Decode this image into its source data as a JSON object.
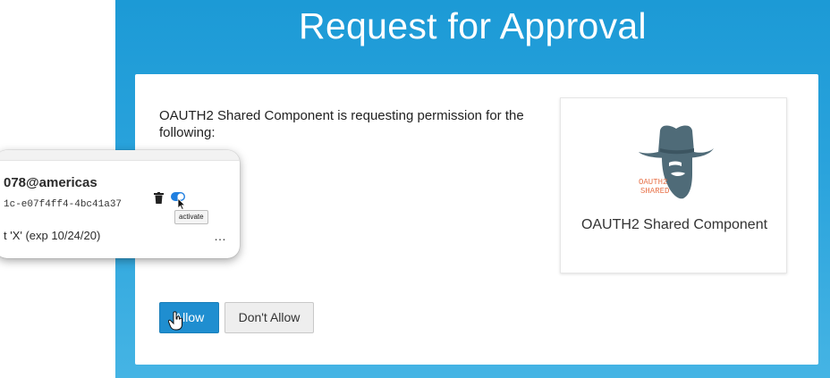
{
  "header": {
    "title": "Request for Approval"
  },
  "permission": {
    "text": "OAUTH2 Shared Component is requesting permission for the following:"
  },
  "app": {
    "name": "OAUTH2 Shared Component",
    "logo_text_line1": "OAUTH2",
    "logo_text_line2": "SHARED"
  },
  "actions": {
    "allow_label": "Allow",
    "deny_label": "Don't Allow"
  },
  "popup": {
    "account": "078@americas",
    "token_id": "1c-e07f4ff4-4bc41a37",
    "expiry": "t 'X' (exp 10/24/20)",
    "tooltip": "activate",
    "more": "…"
  },
  "colors": {
    "background_top": "#1c9ad6",
    "background_bottom": "#45b4e4",
    "allow_button": "#1f8ed0",
    "deny_button": "#eeeeee",
    "logo_gray": "#4f6b78",
    "logo_orange": "#e8734a"
  },
  "icons": [
    "hand-cursor-icon",
    "trash-icon",
    "toggle-icon",
    "pointer-cursor-icon",
    "more-icon"
  ]
}
